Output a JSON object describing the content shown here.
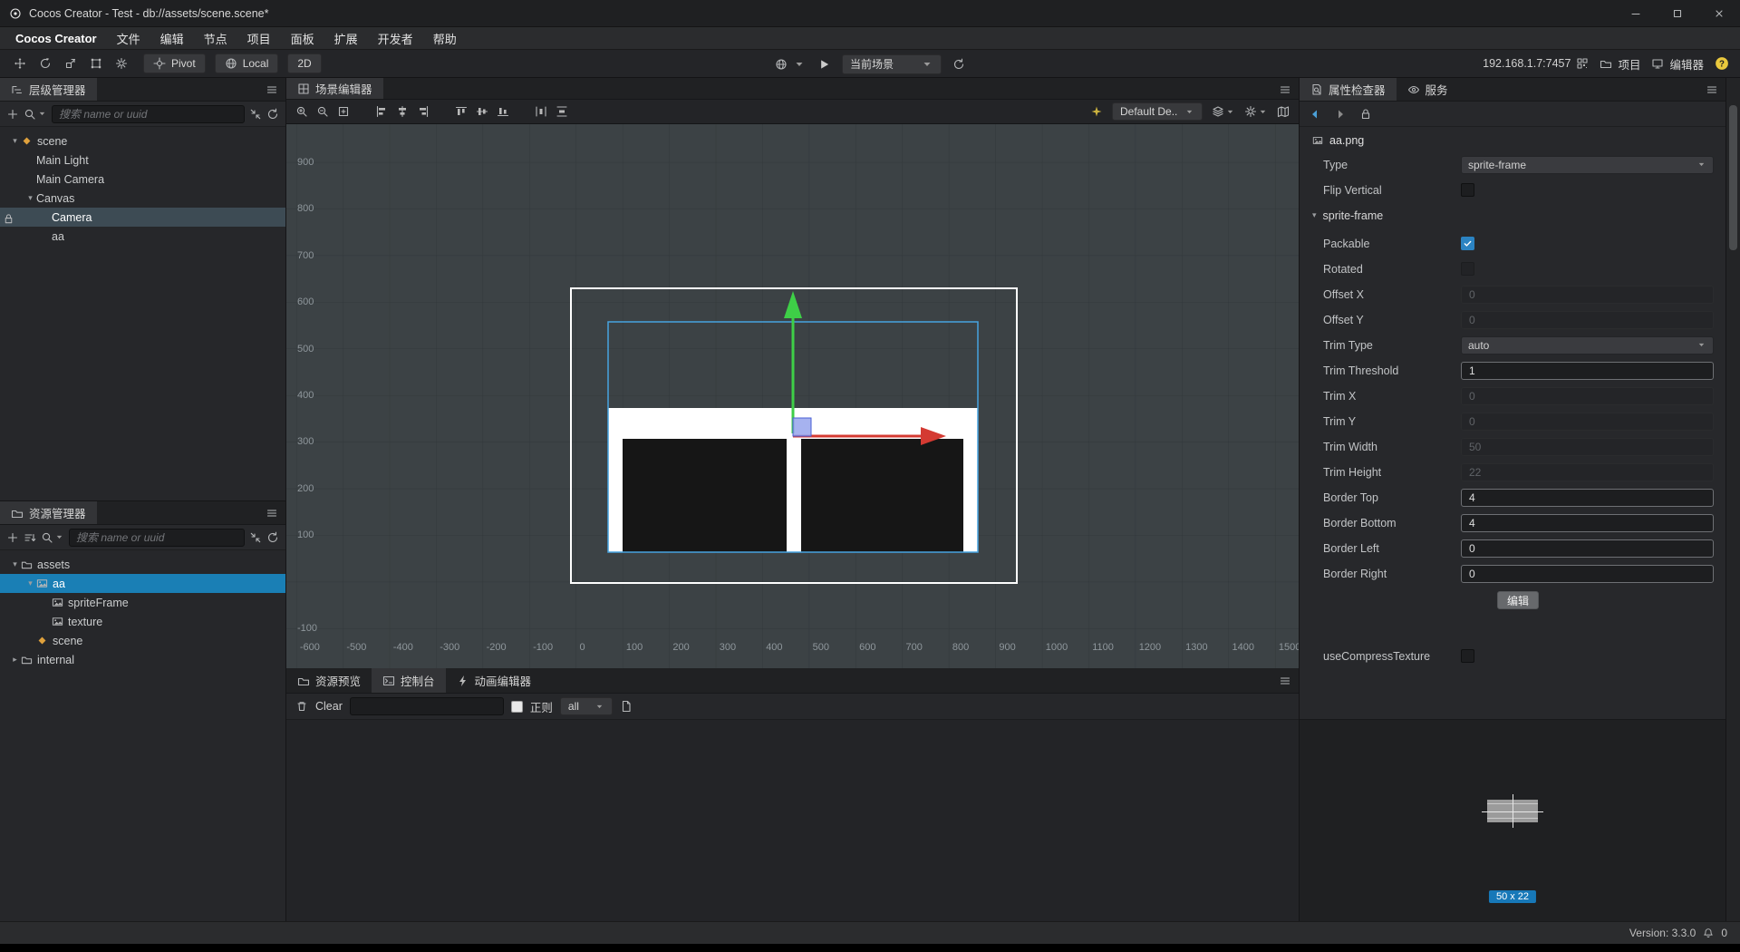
{
  "window": {
    "title": "Cocos Creator - Test - db://assets/scene.scene*"
  },
  "menu": {
    "items": [
      "Cocos Creator",
      "文件",
      "编辑",
      "节点",
      "项目",
      "面板",
      "扩展",
      "开发者",
      "帮助"
    ]
  },
  "toolbar": {
    "tools": [
      "move-tool",
      "rotate-tool",
      "scale-tool",
      "rect-tool",
      "gizmo-settings"
    ],
    "pivot_label": "Pivot",
    "local_label": "Local",
    "mode_label": "2D",
    "scene_select_value": "当前场景",
    "address": "192.168.1.7:7457",
    "project_label": "项目",
    "editor_label": "编辑器"
  },
  "hierarchy": {
    "title": "层级管理器",
    "search_placeholder": "搜索 name or uuid",
    "nodes": [
      {
        "label": "scene",
        "depth": 0,
        "expanded": true,
        "icon": "scene"
      },
      {
        "label": "Main Light",
        "depth": 1
      },
      {
        "label": "Main Camera",
        "depth": 1
      },
      {
        "label": "Canvas",
        "depth": 1,
        "expanded": true
      },
      {
        "label": "Camera",
        "depth": 2,
        "selected": true,
        "locked": true
      },
      {
        "label": "aa",
        "depth": 2
      }
    ]
  },
  "assets": {
    "title": "资源管理器",
    "search_placeholder": "搜索 name or uuid",
    "nodes": [
      {
        "label": "assets",
        "depth": 0,
        "expanded": true,
        "icon": "folder"
      },
      {
        "label": "aa",
        "depth": 1,
        "expanded": true,
        "icon": "image",
        "selected": true
      },
      {
        "label": "spriteFrame",
        "depth": 2,
        "icon": "image"
      },
      {
        "label": "texture",
        "depth": 2,
        "icon": "image"
      },
      {
        "label": "scene",
        "depth": 1,
        "icon": "scene"
      },
      {
        "label": "internal",
        "depth": 0,
        "expanded": false,
        "icon": "folder"
      }
    ]
  },
  "scene_editor": {
    "tab": "场景编辑器",
    "left_tool_groups": [
      [
        "zoom-in",
        "zoom-out",
        "zoom-reset"
      ],
      [
        "align-left",
        "align-center-h",
        "align-right"
      ],
      [
        "align-top",
        "align-center-v",
        "align-bottom"
      ],
      [
        "distribute-h",
        "distribute-v"
      ]
    ],
    "gizmo_dropdown_value": "Default De...",
    "ruler_x": [
      -600,
      -500,
      -400,
      -300,
      -200,
      -100,
      0,
      100,
      200,
      300,
      400,
      500,
      600,
      700,
      800,
      900,
      1000,
      1100,
      1200,
      1300,
      1400,
      1500
    ],
    "ruler_y": [
      900,
      800,
      700,
      600,
      500,
      400,
      300,
      200,
      100,
      -100
    ]
  },
  "console": {
    "tabs": [
      {
        "label": "资源预览",
        "icon": "folder"
      },
      {
        "label": "控制台",
        "icon": "terminal",
        "active": true
      },
      {
        "label": "动画编辑器",
        "icon": "bolt"
      }
    ],
    "clear_label": "Clear",
    "regex_label": "正则",
    "filter_value": "all"
  },
  "inspector": {
    "tabs": [
      {
        "label": "属性检查器",
        "icon": "doc-search",
        "active": true
      },
      {
        "label": "服务",
        "icon": "eye"
      }
    ],
    "asset_name": "aa.png",
    "rows": [
      {
        "label": "Type",
        "type": "dropdown",
        "value": "sprite-frame"
      },
      {
        "label": "Flip Vertical",
        "type": "checkbox",
        "checked": false
      },
      {
        "label": "sprite-frame",
        "type": "section"
      },
      {
        "label": "Packable",
        "type": "checkbox",
        "checked": true
      },
      {
        "label": "Rotated",
        "type": "checkbox",
        "checked": false,
        "disabled": true
      },
      {
        "label": "Offset X",
        "type": "input",
        "value": "0",
        "disabled": true
      },
      {
        "label": "Offset Y",
        "type": "input",
        "value": "0",
        "disabled": true
      },
      {
        "label": "Trim Type",
        "type": "dropdown",
        "value": "auto"
      },
      {
        "label": "Trim Threshold",
        "type": "input",
        "value": "1"
      },
      {
        "label": "Trim X",
        "type": "input",
        "value": "0",
        "disabled": true
      },
      {
        "label": "Trim Y",
        "type": "input",
        "value": "0",
        "disabled": true
      },
      {
        "label": "Trim Width",
        "type": "input",
        "value": "50",
        "disabled": true
      },
      {
        "label": "Trim Height",
        "type": "input",
        "value": "22",
        "disabled": true
      },
      {
        "label": "Border Top",
        "type": "input",
        "value": "4"
      },
      {
        "label": "Border Bottom",
        "type": "input",
        "value": "4"
      },
      {
        "label": "Border Left",
        "type": "input",
        "value": "0"
      },
      {
        "label": "Border Right",
        "type": "input",
        "value": "0"
      }
    ],
    "edit_button": "编辑",
    "use_compress_label": "useCompressTexture",
    "use_compress_checked": false,
    "preview_badge": "50 x 22"
  },
  "statusbar": {
    "version": "Version: 3.3.0",
    "notification_count": "0"
  },
  "colors": {
    "accent_selection_blue": "#1a7fb5",
    "hierarchy_selection": "#3d4b54",
    "checkbox_checked": "#2b83c2",
    "preview_badge": "#1778b8",
    "gizmo_green": "#3ecf47",
    "gizmo_red": "#d43a32",
    "gizmo_handle": "#96a5ec",
    "selection_outline": "#46a3e0",
    "help_yellow": "#e9c83d",
    "scene_icon_orange": "#dfa13c"
  }
}
